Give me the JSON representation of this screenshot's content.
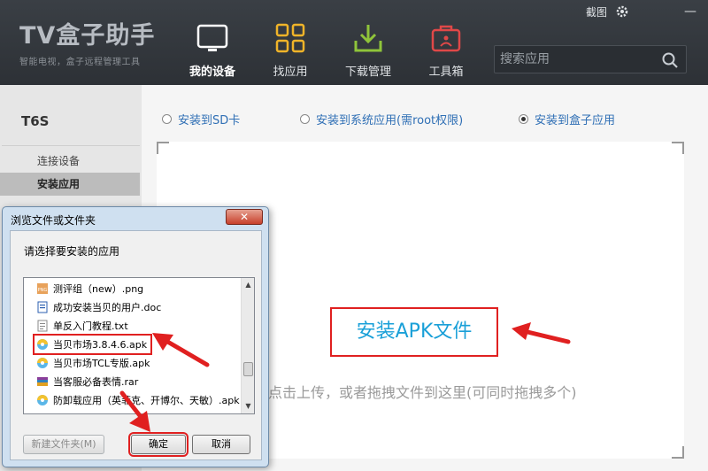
{
  "app": {
    "title": "TV盒子助手",
    "subtitle": "智能电视，盒子远程管理工具"
  },
  "nav": [
    {
      "label": "我的设备",
      "icon": "tablet-icon",
      "active": true
    },
    {
      "label": "找应用",
      "icon": "grid-icon",
      "active": false
    },
    {
      "label": "下载管理",
      "icon": "download-icon",
      "active": false
    },
    {
      "label": "工具箱",
      "icon": "toolbox-icon",
      "active": false
    }
  ],
  "window": {
    "screenshot": "截图",
    "minimize": "—"
  },
  "search": {
    "placeholder": "搜索应用"
  },
  "sidebar": {
    "device": "T6S",
    "items": [
      {
        "label": "连接设备"
      },
      {
        "label": "安装应用",
        "active": true
      }
    ]
  },
  "install_options": [
    {
      "label": "安装到SD卡",
      "checked": false
    },
    {
      "label": "安装到系统应用(需root权限)",
      "checked": false
    },
    {
      "label": "安装到盒子应用",
      "checked": true
    }
  ],
  "dropzone": {
    "button": "安装APK文件",
    "hint": "点击上传，或者拖拽文件到这里(可同时拖拽多个)"
  },
  "dialog": {
    "title": "浏览文件或文件夹",
    "close": "✕",
    "prompt": "请选择要安装的应用",
    "files": [
      {
        "name": "测评组（new）.png",
        "icon": "png-file-icon"
      },
      {
        "name": "成功安装当贝的用户.doc",
        "icon": "doc-file-icon"
      },
      {
        "name": "单反入门教程.txt",
        "icon": "txt-file-icon"
      },
      {
        "name": "当贝市场3.8.4.6.apk",
        "icon": "apk-file-icon",
        "selected": true
      },
      {
        "name": "当贝市场TCL专版.apk",
        "icon": "apk-file-icon"
      },
      {
        "name": "当客服必备表情.rar",
        "icon": "rar-file-icon"
      },
      {
        "name": "防卸载应用（英菲克、开博尔、天敏）.apk",
        "icon": "apk-file-icon"
      }
    ],
    "new_folder": "新建文件夹(M)",
    "ok": "确定",
    "cancel": "取消"
  },
  "colors": {
    "accent_blue": "#1aa0d8",
    "annotation_red": "#e02020",
    "topbar": "#33373c"
  }
}
